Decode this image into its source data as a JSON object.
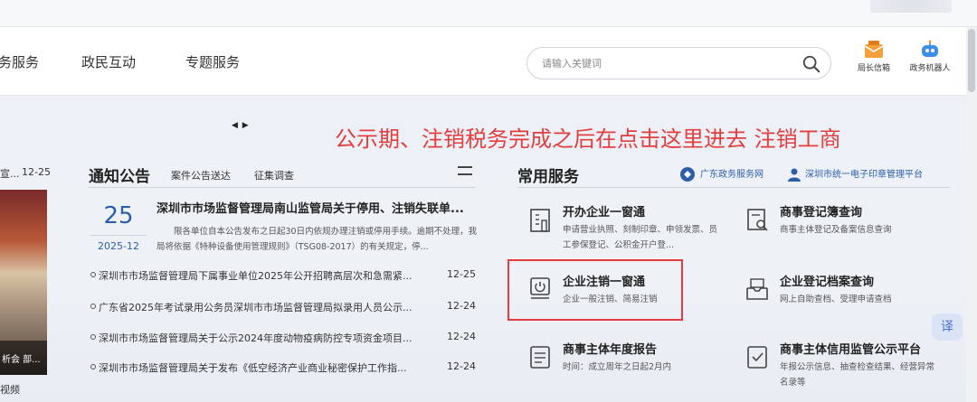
{
  "nav": {
    "items": [
      "务服务",
      "政民互动",
      "专题服务"
    ],
    "search_placeholder": "请输入关键词",
    "tools": [
      {
        "label": "局长信箱",
        "icon": "mailbox-icon"
      },
      {
        "label": "政务机器人",
        "icon": "robot-icon"
      }
    ]
  },
  "carousel": {
    "arrows": "◀ ▶"
  },
  "annotation": "公示期、注销税务完成之后在点击这里进去 注销工商",
  "left_strip": {
    "date_prefix": "宣...",
    "date": "12-25",
    "caption": "析会 部...",
    "video_label": "视频"
  },
  "notices": {
    "title": "通知公告",
    "tabs": [
      "案件公告送达",
      "征集调查"
    ],
    "featured": {
      "day": "25",
      "year_month": "2025-12",
      "title": "深圳市市场监督管理局南山监管局关于停用、注销失联单...",
      "body": "限各单位自本公告发布之日起30日内依规办理注销或停用手续。逾期不处理，我局将依据《特种设备使用管理规则》（TSG08-2017）的有关规定，停..."
    },
    "items": [
      {
        "text": "深圳市市场监督管理局下属事业单位2025年公开招聘高层次和急需紧...",
        "date": "12-25"
      },
      {
        "text": "广东省2025年考试录用公务员深圳市市场监督管理局拟录用人员公示...",
        "date": "12-24"
      },
      {
        "text": "深圳市市场监督管理局关于公示2024年度动物疫病防控专项资金项目...",
        "date": "12-24"
      },
      {
        "text": "深圳市市场监督管理局关于发布《低空经济产业商业秘密保护工作指...",
        "date": "12-24"
      }
    ]
  },
  "services": {
    "title": "常用服务",
    "links": [
      {
        "label": "广东政务服务网",
        "icon": "guangdong-gov-icon"
      },
      {
        "label": "深圳市统一电子印章管理平台",
        "icon": "user-icon"
      }
    ],
    "items": [
      {
        "name": "开办企业一窗通",
        "desc": "申请营业执照、刻制印章、申领发票、员工参保登记、公积金开户登...",
        "icon": "building-icon"
      },
      {
        "name": "商事登记簿查询",
        "desc": "商事主体登记及备案信息查询",
        "icon": "search-document-icon"
      },
      {
        "name": "企业注销一窗通",
        "desc": "企业一般注销、简易注销",
        "icon": "power-document-icon"
      },
      {
        "name": "企业登记档案查询",
        "desc": "网上自助查档、受理申请查档",
        "icon": "archive-icon"
      },
      {
        "name": "商事主体年度报告",
        "desc": "时间：成立周年之日起2月内",
        "icon": "report-icon"
      },
      {
        "name": "商事主体信用监管公示平台",
        "desc": "年报公示信息、抽查检查结果、经营异常名录等",
        "icon": "credit-document-icon"
      }
    ]
  },
  "translate_label": "译",
  "colors": {
    "accent": "#2c5fa8",
    "annotation": "#e43d3d",
    "highlight": "#e43d3d"
  }
}
